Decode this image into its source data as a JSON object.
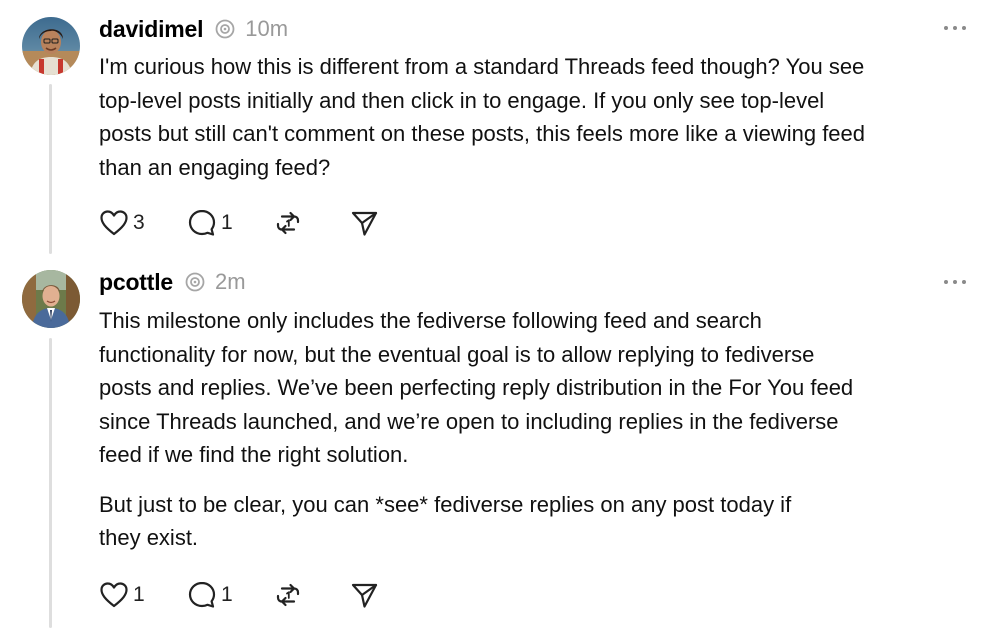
{
  "posts": [
    {
      "username": "davidimel",
      "timestamp": "10m",
      "paragraphs": [
        "I'm curious how this is different from a standard Threads feed though? You see\ntop-level posts initially and then click in to engage. If you only see top-level\nposts but still can't comment on these posts, this feels more like a viewing feed\nthan an engaging feed?"
      ],
      "likes": "3",
      "replies": "1",
      "icons": {
        "avatar": "user-avatar-icon",
        "fediverse": "fediverse-icon",
        "more": "more-options-icon",
        "like": "heart-icon",
        "reply": "comment-icon",
        "repost": "repost-icon",
        "share": "share-send-icon"
      }
    },
    {
      "username": "pcottle",
      "timestamp": "2m",
      "paragraphs": [
        "This milestone only includes the fediverse following feed and search\nfunctionality for now, but the eventual goal is to allow replying to fediverse\nposts and replies. We’ve been perfecting reply distribution in the For You feed\nsince Threads launched, and we’re open to including replies in the fediverse\nfeed if we find the right solution.",
        "But just to be clear, you can *see* fediverse replies on any post today if\nthey exist."
      ],
      "likes": "1",
      "replies": "1",
      "icons": {
        "avatar": "user-avatar-icon",
        "fediverse": "fediverse-icon",
        "more": "more-options-icon",
        "like": "heart-icon",
        "reply": "comment-icon",
        "repost": "repost-icon",
        "share": "share-send-icon"
      }
    }
  ],
  "colors": {
    "text": "#111111",
    "muted": "#999999",
    "thread_line": "#dedede",
    "icon": "#222222"
  }
}
